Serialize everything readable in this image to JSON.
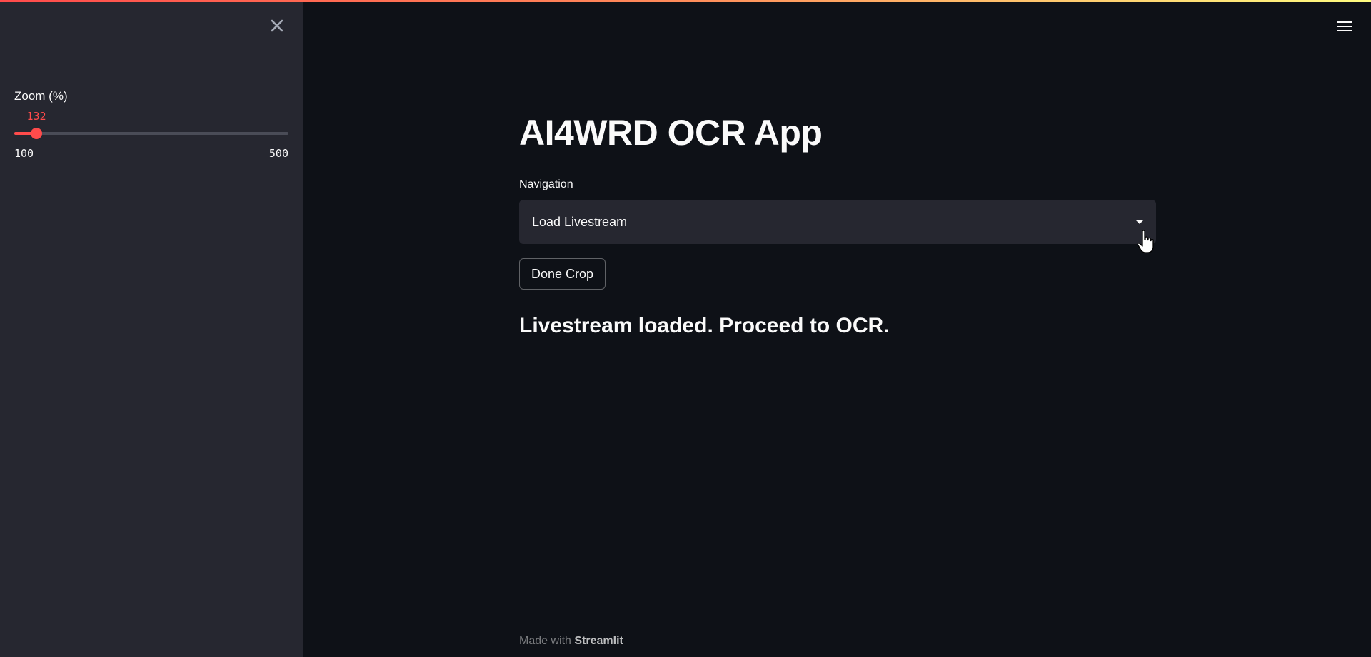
{
  "sidebar": {
    "close_icon": "close-icon",
    "slider": {
      "label": "Zoom (%)",
      "value": "132",
      "min": "100",
      "max": "500",
      "fraction": 0.08,
      "accent": "#ff4b4b"
    }
  },
  "header": {
    "menu_icon": "hamburger-menu-icon"
  },
  "main": {
    "title": "AI4WRD OCR App",
    "navigation": {
      "label": "Navigation",
      "selected": "Load Livestream"
    },
    "done_button": "Done Crop",
    "status": "Livestream loaded. Proceed to OCR."
  },
  "footer": {
    "made_with": "Made with",
    "brand": "Streamlit"
  },
  "colors": {
    "background": "#0e1117",
    "sidebar": "#262730",
    "accent": "#ff4b4b",
    "text": "#fafafa"
  }
}
